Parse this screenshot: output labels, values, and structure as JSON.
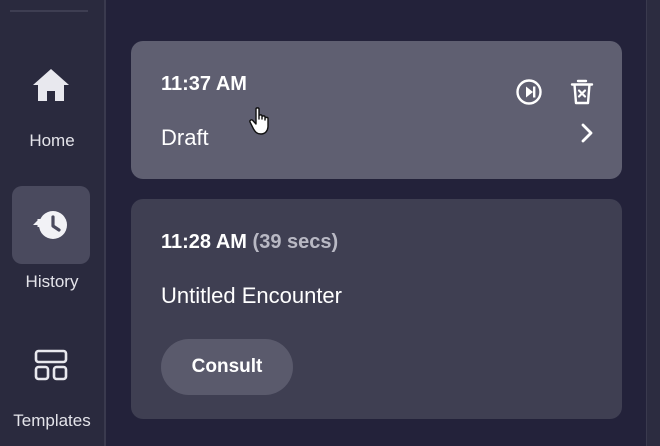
{
  "sidebar": {
    "items": [
      {
        "label": "Home",
        "icon": "home-icon",
        "active": false
      },
      {
        "label": "History",
        "icon": "history-icon",
        "active": true
      },
      {
        "label": "Templates",
        "icon": "templates-icon",
        "active": false
      }
    ]
  },
  "sessions": [
    {
      "time": "11:37 AM",
      "duration": "",
      "title": "Draft",
      "actions": [
        "resume-icon",
        "delete-icon",
        "chevron-right-icon"
      ]
    },
    {
      "time": "11:28 AM",
      "duration": "(39 secs)",
      "title": "Untitled Encounter",
      "tag": "Consult"
    }
  ],
  "colors": {
    "background": "#23223a",
    "sidebar": "#2a2a3e",
    "card_active": "#5f5f71",
    "card": "#3f3f52",
    "pill": "#5a5a6c"
  }
}
